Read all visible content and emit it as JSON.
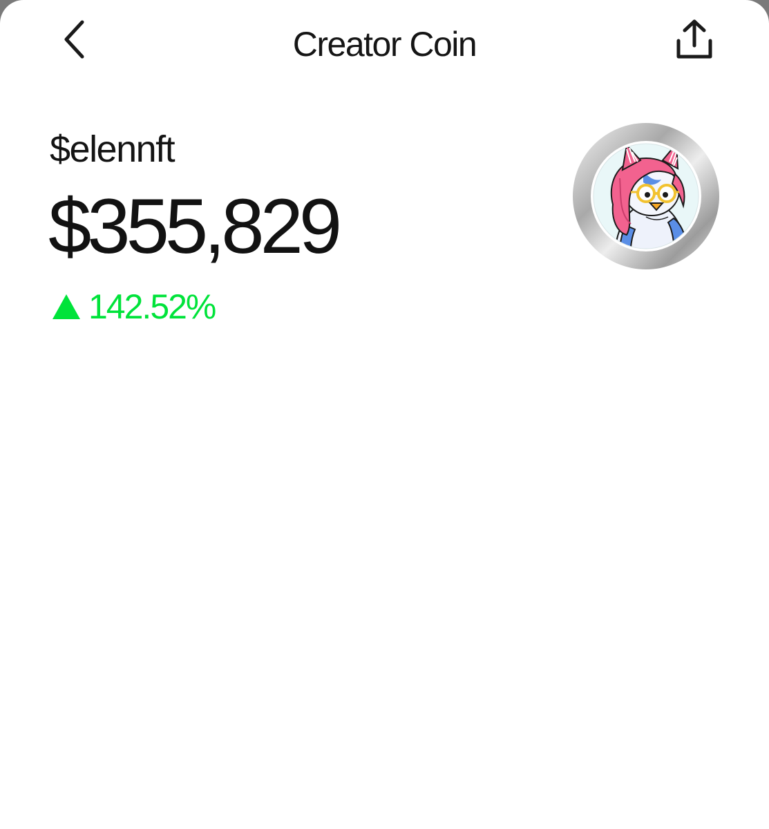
{
  "header": {
    "title": "Creator Coin",
    "back_icon": "chevron-left-icon",
    "share_icon": "share-upload-icon"
  },
  "coin": {
    "ticker": "$elennft",
    "price": "$355,829",
    "change_percent": "142.52%",
    "change_direction": "up",
    "change_icon": "triangle-up-icon",
    "avatar_icon": "penguin-avatar"
  },
  "colors": {
    "background": "#ffffff",
    "text": "#121212",
    "positive": "#00e33a",
    "avatar_ring": "#bdbdbd",
    "avatar_hair": "#f2628f",
    "avatar_glasses": "#f2c230"
  }
}
